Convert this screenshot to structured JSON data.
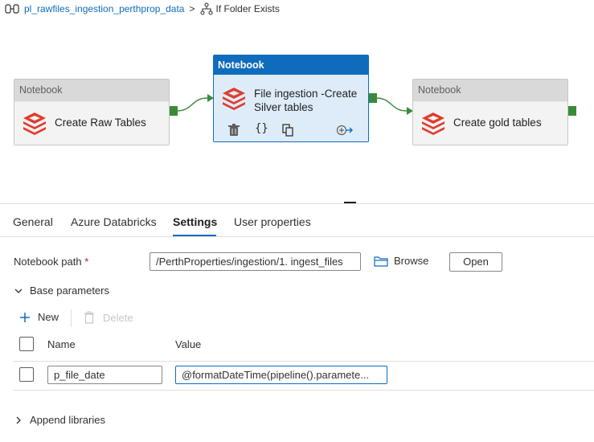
{
  "breadcrumb": {
    "pipeline_name": "pl_rawfiles_ingestion_perthprop_data",
    "separator": ">",
    "current": "If Folder Exists"
  },
  "activities": [
    {
      "type_label": "Notebook",
      "title_line1": "Create Raw Tables",
      "title_line2": ""
    },
    {
      "type_label": "Notebook",
      "title_line1": "File ingestion -Create",
      "title_line2": "Silver tables",
      "selected": true
    },
    {
      "type_label": "Notebook",
      "title_line1": "Create gold tables",
      "title_line2": ""
    }
  ],
  "activity_actions": {
    "delete": "delete-icon",
    "code": "code-braces-icon",
    "copy": "copy-icon",
    "add_output": "add-output-icon"
  },
  "tabs": [
    {
      "label": "General"
    },
    {
      "label": "Azure Databricks"
    },
    {
      "label": "Settings",
      "active": true
    },
    {
      "label": "User properties"
    }
  ],
  "settings": {
    "notebook_path_label": "Notebook path",
    "required_marker": "*",
    "notebook_path_value": "/PerthProperties/ingestion/1. ingest_files",
    "browse_label": "Browse",
    "open_label": "Open",
    "base_parameters_label": "Base parameters",
    "new_label": "New",
    "delete_label": "Delete",
    "col_name": "Name",
    "col_value": "Value",
    "parameters": [
      {
        "name": "p_file_date",
        "value": "@formatDateTime(pipeline().paramete..."
      }
    ],
    "append_libraries_label": "Append libraries"
  },
  "colors": {
    "accent": "#0f6cbd",
    "success_port": "#3a8a3a",
    "databricks": "#e03d2f"
  }
}
